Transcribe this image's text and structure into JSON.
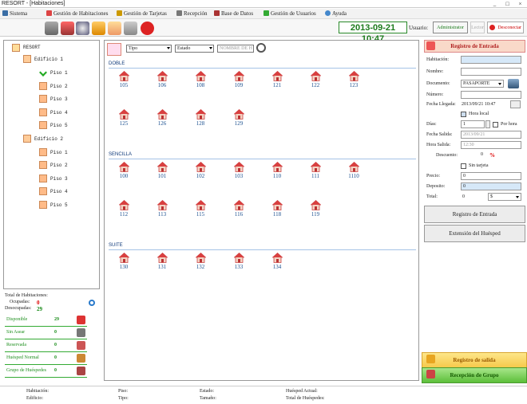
{
  "window": {
    "title": "RESORT - [Habitaciones]",
    "controls": [
      "_",
      "□",
      "×"
    ]
  },
  "menu": [
    {
      "label": "Sistema",
      "icon": "system-icon"
    },
    {
      "label": "Gestión de Habitaciones",
      "icon": "house-icon"
    },
    {
      "label": "Gestión de Tarjetas",
      "icon": "card-icon"
    },
    {
      "label": "Recepción",
      "icon": "reception-icon"
    },
    {
      "label": "Base de Datos",
      "icon": "database-icon"
    },
    {
      "label": "Gestión de Usuarios",
      "icon": "users-icon"
    },
    {
      "label": "Ayuda",
      "icon": "help-icon"
    }
  ],
  "toolbar": {
    "datetime": "2013-09-21  10:47",
    "user_label": "Usuario:",
    "user_value": "Administrator",
    "lector_label": "Lector",
    "disconnect_label": "Desconectar"
  },
  "tree": {
    "root": "RESORT",
    "buildings": [
      {
        "label": "Edificio 1",
        "floors": [
          "Piso 1",
          "Piso 2",
          "Piso 3",
          "Piso 4",
          "Piso 5"
        ]
      },
      {
        "label": "Edificio 2",
        "floors": [
          "Piso 1",
          "Piso 2",
          "Piso 3",
          "Piso 4",
          "Piso 5"
        ]
      }
    ]
  },
  "summary": {
    "total_label": "Total de Habitaciones:",
    "occupied_label": "Ocupadas:",
    "occupied_value": "0",
    "vacant_label": "Desocupadas:",
    "vacant_value": "29"
  },
  "status_counts": [
    {
      "label": "Disponible",
      "value": "29",
      "icon": "available-icon",
      "color": "#d33"
    },
    {
      "label": "Sin Asear",
      "value": "0",
      "icon": "dirty-icon",
      "color": "#777"
    },
    {
      "label": "Reservada",
      "value": "0",
      "icon": "reserved-icon",
      "color": "#c55"
    },
    {
      "label": "Huésped Normal",
      "value": "0",
      "icon": "guest-icon",
      "color": "#c83"
    },
    {
      "label": "Grupo de Huéspedes",
      "value": "0",
      "icon": "group-icon",
      "color": "#a44"
    }
  ],
  "filters": {
    "tipo": "Tipo",
    "estado": "Estado",
    "search_placeholder": "NOMBRE DE H"
  },
  "sections": [
    {
      "name": "DOBLE",
      "rooms": [
        "105",
        "106",
        "108",
        "109",
        "121",
        "122",
        "123",
        "125",
        "126",
        "128",
        "129"
      ]
    },
    {
      "name": "SENCILLA",
      "rooms": [
        "100",
        "101",
        "102",
        "103",
        "110",
        "111",
        "1110",
        "112",
        "113",
        "115",
        "116",
        "118",
        "119"
      ]
    },
    {
      "name": "SUITE",
      "rooms": [
        "130",
        "131",
        "132",
        "133",
        "134"
      ]
    }
  ],
  "checkin": {
    "header": "Registro de Entrada",
    "habitacion_label": "Habitación:",
    "nombre_label": "Nombre:",
    "documento_label": "Documento:",
    "documento_value": "PASAPORTE",
    "numero_label": "Número:",
    "fecha_llegada_label": "Fecha Llegada:",
    "fecha_llegada_value": "2013/09/21 10:47",
    "hora_local_label": "Hora local",
    "dias_label": "Días:",
    "dias_value": "1",
    "por_hora_label": "Por hora",
    "fecha_salida_label": "Fecha Salida:",
    "fecha_salida_value": "2013/09/21",
    "hora_salida_label": "Hora Salida:",
    "hora_salida_value": "12:30",
    "descuento_label": "Descuento:",
    "descuento_value": "0",
    "percent": "%",
    "sin_tarjeta_label": "Sin tarjeta",
    "precio_label": "Precio:",
    "precio_value": "0",
    "deposito_label": "Deposito:",
    "deposito_value": "0",
    "total_label": "Total:",
    "total_value": "0",
    "currency": "$",
    "btn_registro": "Registro de Entrada",
    "btn_extension": "Extensión del Huésped"
  },
  "bottom_buttons": {
    "checkout": "Registro de salida",
    "group": "Recepción de Grupo"
  },
  "statusbar": {
    "habitacion": "Habitación:",
    "edificio": "Edificio:",
    "piso": "Piso:",
    "tipo": "Tipo:",
    "estado": "Estado:",
    "tamano": "Tamaño:",
    "huesped": "Huésped Actual:",
    "total_huespedes": "Total de Huéspedes:"
  }
}
